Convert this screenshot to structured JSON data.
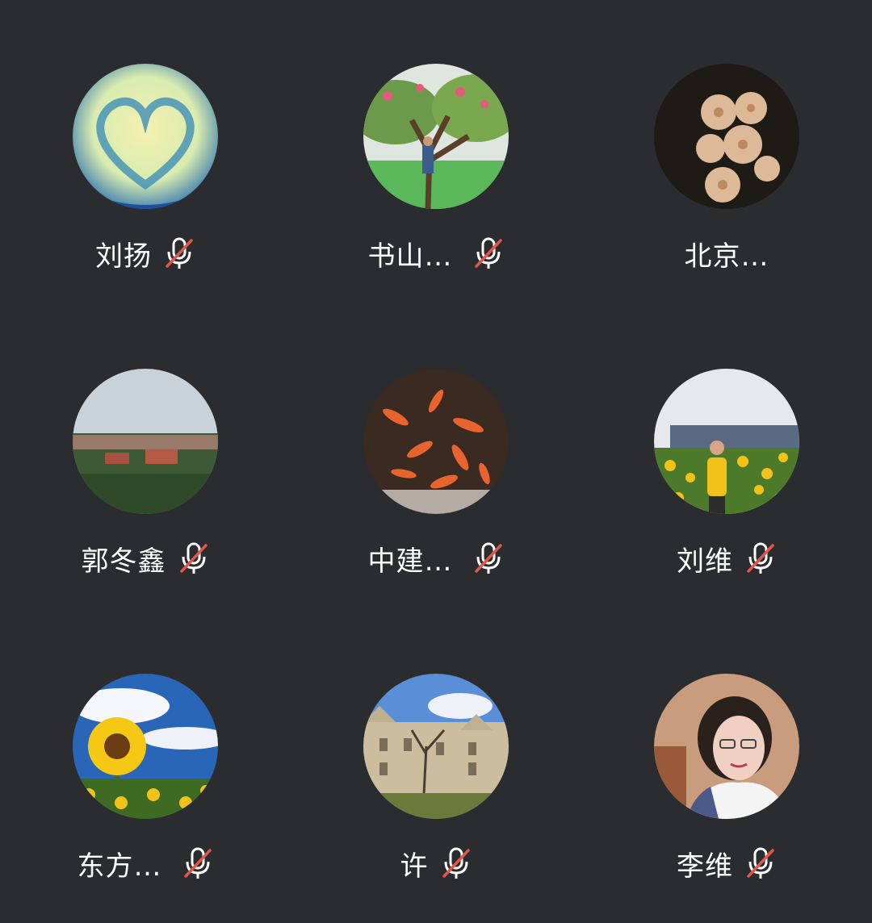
{
  "participants": [
    {
      "name": "刘扬",
      "muted": true,
      "avatar": "heart-icon"
    },
    {
      "name": "书山…",
      "muted": true,
      "avatar": "tree-photo"
    },
    {
      "name": "北京…",
      "muted": false,
      "avatar": "flowers-photo"
    },
    {
      "name": "郭冬鑫",
      "muted": true,
      "avatar": "landscape-photo"
    },
    {
      "name": "中建…",
      "muted": true,
      "avatar": "koi-fish-photo"
    },
    {
      "name": "刘维",
      "muted": true,
      "avatar": "sunflower-field-photo"
    },
    {
      "name": "东方…",
      "muted": true,
      "avatar": "sunflower-sky-photo"
    },
    {
      "name": "许",
      "muted": true,
      "avatar": "castle-photo"
    },
    {
      "name": "李维",
      "muted": true,
      "avatar": "portrait-photo"
    }
  ],
  "colors": {
    "background": "#2a2c30",
    "mute_slash": "#e0564a",
    "text": "#ffffff"
  }
}
